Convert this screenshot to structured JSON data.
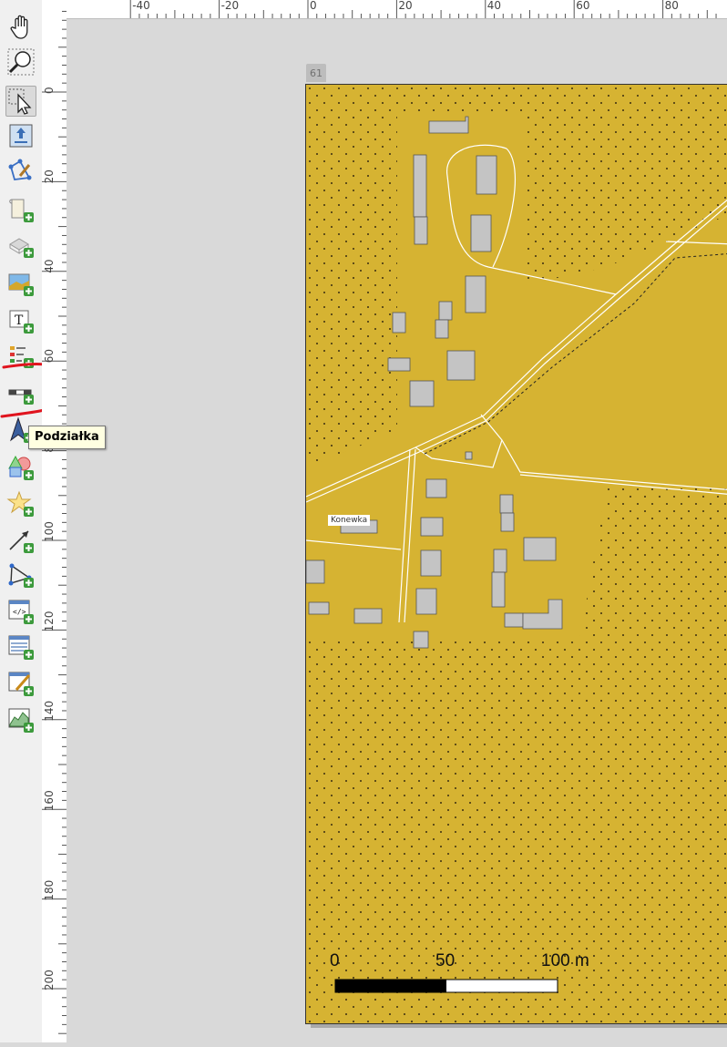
{
  "toolbar": {
    "items": [
      {
        "name": "pan-tool",
        "icon": "hand-icon"
      },
      {
        "name": "zoom-tool",
        "icon": "magnifier-icon"
      },
      {
        "name": "select-tool",
        "icon": "select-arrow-icon",
        "active": true
      },
      {
        "name": "move-content-tool",
        "icon": "move-content-icon"
      },
      {
        "name": "edit-nodes-tool",
        "icon": "edit-nodes-icon"
      },
      {
        "name": "add-map-tool",
        "icon": "add-map-icon"
      },
      {
        "name": "add-3d-map-tool",
        "icon": "add-3d-map-icon"
      },
      {
        "name": "add-picture-tool",
        "icon": "add-picture-icon"
      },
      {
        "name": "add-label-tool",
        "icon": "add-label-icon"
      },
      {
        "name": "add-legend-tool",
        "icon": "add-legend-icon"
      },
      {
        "name": "add-scalebar-tool",
        "icon": "add-scalebar-icon"
      },
      {
        "name": "add-north-arrow-tool",
        "icon": "add-north-arrow-icon"
      },
      {
        "name": "add-shape-tool",
        "icon": "add-shape-icon"
      },
      {
        "name": "add-marker-tool",
        "icon": "add-marker-icon"
      },
      {
        "name": "add-arrow-tool",
        "icon": "add-arrow-icon"
      },
      {
        "name": "add-polygon-tool",
        "icon": "add-polygon-icon"
      },
      {
        "name": "add-html-tool",
        "icon": "add-html-icon"
      },
      {
        "name": "add-attribute-table-tool",
        "icon": "add-attribute-table-icon"
      },
      {
        "name": "add-fixed-table-tool",
        "icon": "add-fixed-table-icon"
      },
      {
        "name": "add-elevation-profile-tool",
        "icon": "add-elevation-profile-icon"
      }
    ],
    "highlighted_tool": "add-scalebar-tool"
  },
  "tooltip": {
    "text": "Podziałka"
  },
  "rulers": {
    "horizontal_labels": [
      "-40",
      "-20",
      "0",
      "20",
      "40",
      "60",
      "80"
    ],
    "vertical_labels": [
      "0",
      "20",
      "40",
      "60",
      "80",
      "100",
      "120",
      "140",
      "160",
      "180",
      "200"
    ]
  },
  "page": {
    "number": "61"
  },
  "map": {
    "place_label": "Konewka",
    "background_color": "#d6b332",
    "building_color": "#c4c4c4"
  },
  "scalebar": {
    "labels": [
      "0",
      "50",
      "100 m"
    ]
  },
  "colors": {
    "annotation": "#e0141e",
    "canvas": "#d9d9d9",
    "toolbar": "#f0f0f0"
  }
}
